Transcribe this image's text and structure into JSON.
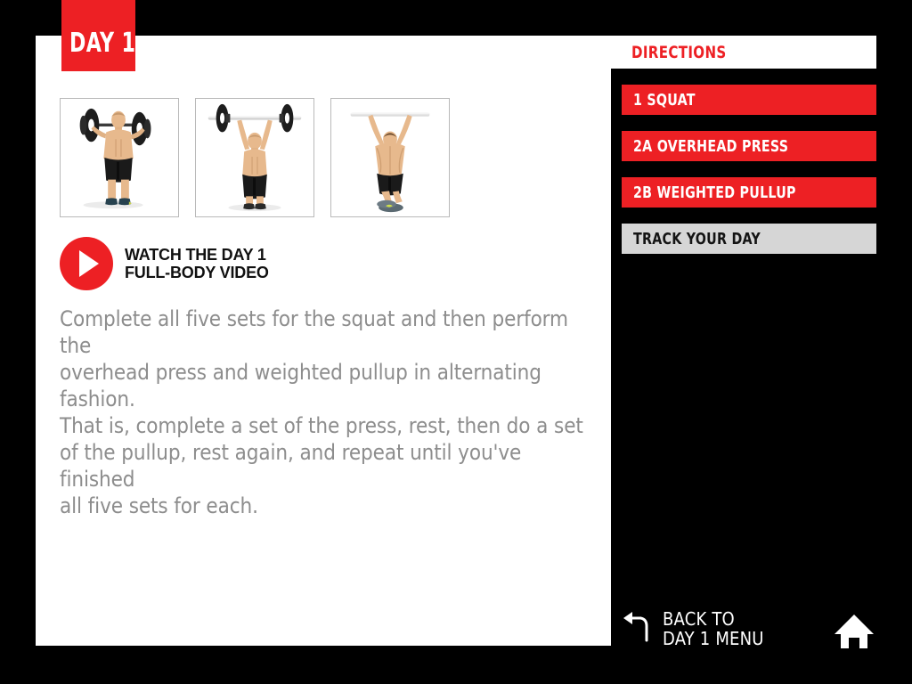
{
  "day_tab": {
    "label": "DAY 1"
  },
  "photos": [
    {
      "name": "barbell-squat-photo",
      "alt": "Man holding barbell across shoulders for squat"
    },
    {
      "name": "overhead-press-photo",
      "alt": "Man pressing barbell overhead"
    },
    {
      "name": "weighted-pullup-photo",
      "alt": "Man hanging from bar performing weighted pullup"
    }
  ],
  "video": {
    "label": "WATCH THE DAY 1\nFULL-BODY VIDEO",
    "icon": "play-icon"
  },
  "instructions": "Complete all five sets for the squat and then perform the\noverhead press and weighted pullup in alternating fashion.\nThat is, complete a set of the press, rest, then do a set\nof the pullup, rest again, and repeat until you've finished\nall five sets for each.",
  "sidebar": {
    "header": "DIRECTIONS",
    "items": [
      {
        "label": "1 SQUAT",
        "style": "red"
      },
      {
        "label": "2A OVERHEAD PRESS",
        "style": "red"
      },
      {
        "label": "2B WEIGHTED PULLUP",
        "style": "red"
      },
      {
        "label": "TRACK YOUR DAY",
        "style": "gray"
      }
    ]
  },
  "footer": {
    "back_label": "BACK TO\nDAY 1 MENU",
    "back_icon": "back-arrow-icon",
    "home_icon": "home-icon"
  },
  "colors": {
    "accent_red": "#ED2024",
    "panel_white": "#FFFFFF",
    "gray_button": "#D6D6D6",
    "body_text_gray": "#8D8D8D",
    "background_black": "#000000"
  }
}
